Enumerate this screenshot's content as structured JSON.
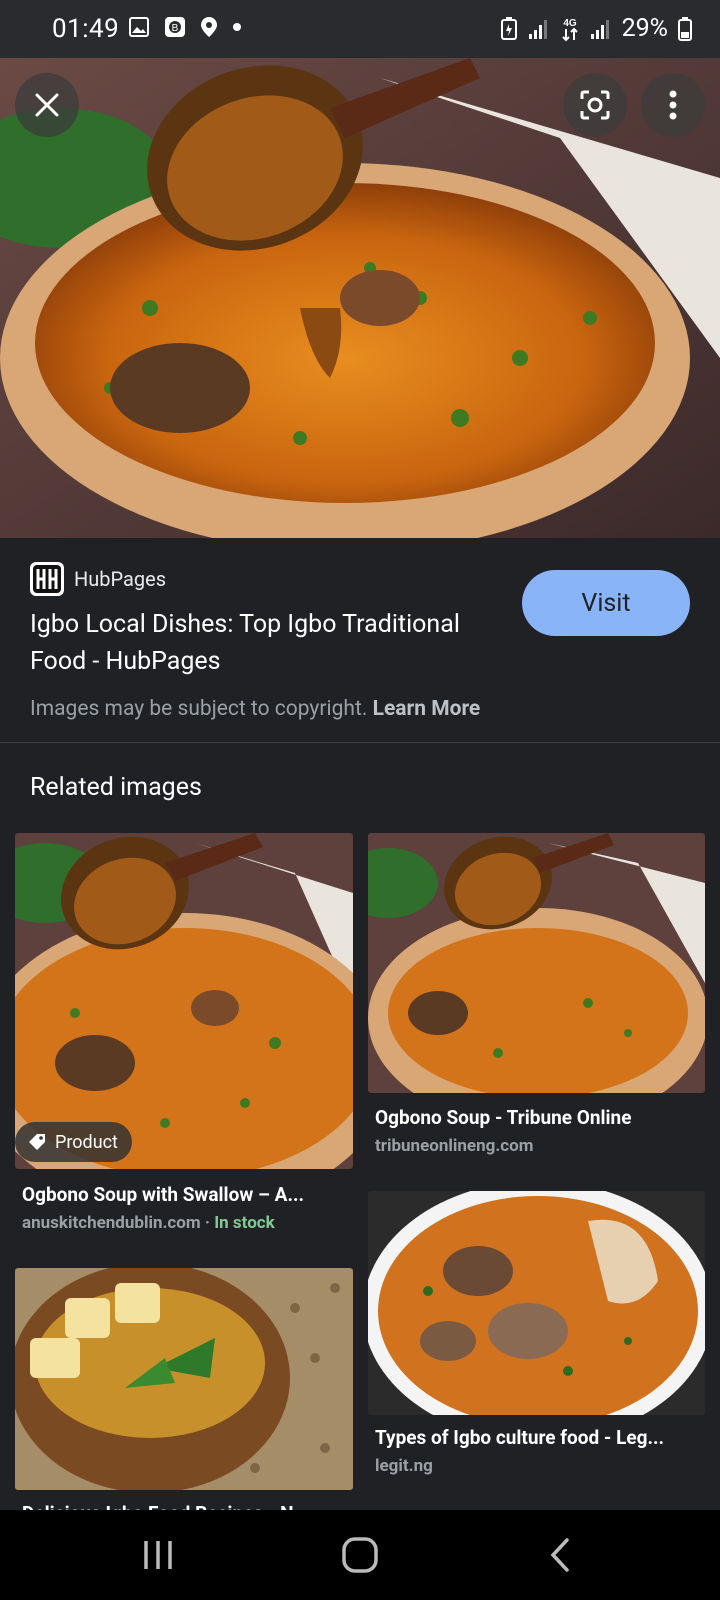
{
  "status_bar": {
    "time": "01:49",
    "battery": "29%",
    "network": "4G"
  },
  "hero": {
    "close_icon": "close-icon",
    "lens_icon": "lens-icon",
    "more_icon": "more-vert-icon"
  },
  "result": {
    "source": "HubPages",
    "title": "Igbo Local Dishes: Top Igbo Traditional Food - HubPages",
    "visit_label": "Visit",
    "copyright_text": "Images may be subject to copyright.",
    "learn_more": "Learn More"
  },
  "related": {
    "heading": "Related images",
    "items": [
      {
        "badge": "Product",
        "title": "Ogbono Soup with Swallow – A...",
        "domain": "anuskitchendublin.com",
        "separator": "·",
        "stock": "In stock"
      },
      {
        "title": "Ogbono Soup - Tribune Online",
        "domain": "tribuneonlineng.com"
      },
      {
        "title": "Delicious Igbo Food Recipes - N..."
      },
      {
        "title": "Types of Igbo culture food - Leg...",
        "domain": "legit.ng"
      }
    ]
  },
  "colors": {
    "background": "#202124",
    "accent": "#8ab4f8",
    "in_stock": "#81c995"
  }
}
